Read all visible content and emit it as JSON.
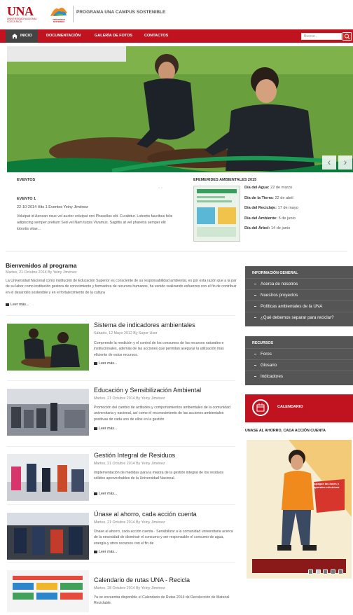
{
  "header": {
    "logo_text": "UNA",
    "logo_sub": "UNIVERSIDAD NACIONAL COSTA RICA",
    "campus_logo_text": "UNIVERSIDAD SOSTENIBLE",
    "title": "PROGRAMA UNA CAMPUS SOSTENIBLE"
  },
  "nav": {
    "items": [
      {
        "label": "INICIO",
        "icon": "home-icon"
      },
      {
        "label": "DOCUMENTACIÓN"
      },
      {
        "label": "GALERÍA DE FOTOS"
      },
      {
        "label": "CONTACTOS"
      }
    ],
    "search_placeholder": "Buscar...",
    "accent": "#c1121f"
  },
  "events": {
    "heading": "EVENTOS",
    "name": "EVENTO 1",
    "meta": "22-10-2014 Hits 1 Eventos Yeiny Jiménez",
    "description": "Volutpat id Aenean risus vel auctor volutpat orci Phasellus elit. Curabitur. Lobortis faucibus felis adipiscing semper pretium Sed vel Nam turpis Vivamus. Sagittis at vel pharetra semper elit lobortis vitae..."
  },
  "efemerides": {
    "heading": "EFEMERIDES AMBIENTALES 2015",
    "items": [
      {
        "name": "Día del Agua:",
        "date": "22 de marzo"
      },
      {
        "name": "Día de la Tierra:",
        "date": "22 de abril"
      },
      {
        "name": "Día del Reciclaje:",
        "date": "17 de mayo"
      },
      {
        "name": "Día del Ambiente:",
        "date": "5 de junio"
      },
      {
        "name": "Día del Árbol:",
        "date": "14 de junio"
      }
    ]
  },
  "welcome": {
    "title": "Bienvenidos al programa",
    "meta": "Martes, 21 Octubre 2014   By Yeiny Jiménez",
    "text": "La Universidad Nacional como institución de Educación Superior es consciente de su responsabilidad ambiental, es por esta razón que a la par de su labor como institución gestora de conocimiento y formadora de recursos humanos, ha venido realizando esfuerzos con el fin de contribuir en el desarrollo sostenible y en el fortalecimiento de la cultura",
    "read_more": "Leer más..."
  },
  "articles": [
    {
      "title": "Sistema de indicadores ambientales",
      "meta": "Sábado, 12 Mayo 2012   By Super User",
      "text": "Comprende la medición y el control de los consumos de los recursos naturales e institucionales, además de las acciones que permitan asegurar la utilización más eficiente de estos recursos.",
      "read_more": "Leer más..."
    },
    {
      "title": "Educación y Sensibilización Ambiental",
      "meta": "Martes, 21 Octubre 2014   By Yeiny Jiménez",
      "text": "Promoción del cambio de actitudes y comportamientos ambientales de la comunidad universitaria y nacional, así como el reconocimiento de las acciones ambientales positivas de cada uno de ellos en la gestión",
      "read_more": "Leer más..."
    },
    {
      "title": "Gestión Integral de Residuos",
      "meta": "Martes, 21 Octubre 2014   By Yeiny Jiménez",
      "text": "Implementación de medidas para la mejora de la gestión integral de los residuos sólidos aprovechables de la Universidad Nacional.",
      "read_more": "Leer más..."
    },
    {
      "title": "Únase al ahorro, cada acción cuenta",
      "meta": "Martes, 21 Octubre 2014   By Yeiny Jiménez",
      "text": "Únase al ahorro, cada acción cuenta · Sensibilizar a la comunidad universitaria acerca de la necesidad de disminuir el consumo y ser responsable el consumo de agua, energía y otros recursos con el fin de",
      "read_more": "Leer más..."
    },
    {
      "title": "Calendario de rutas UNA - Recicla",
      "meta": "Martes, 28 Octubre 2014   By Yeiny Jiménez",
      "text": "Ya se encuentra disponible el Calendario de Rutas 2014 de Recolección de Material Reciclable."
    }
  ],
  "sidebar": {
    "info": {
      "heading": "INFORMACIÓN GENERAL",
      "items": [
        "Acerca de nosotros",
        "Nuestros proyectos",
        "Políticas ambientales de la UNA",
        "¿Qué debemos separar para reciclar?"
      ]
    },
    "resources": {
      "heading": "RECURSOS",
      "items": [
        "Foros",
        "Glosario",
        "Indicadores"
      ]
    },
    "calendar_label": "CALENDARIO",
    "ahorro_title": "UNASE AL AHORRO, CADA ACCIÓN CUENTA",
    "poster_text": "Apague las luces y aparatos eléctricos",
    "poster_dots_total": 5,
    "poster_dot_active": 2
  }
}
